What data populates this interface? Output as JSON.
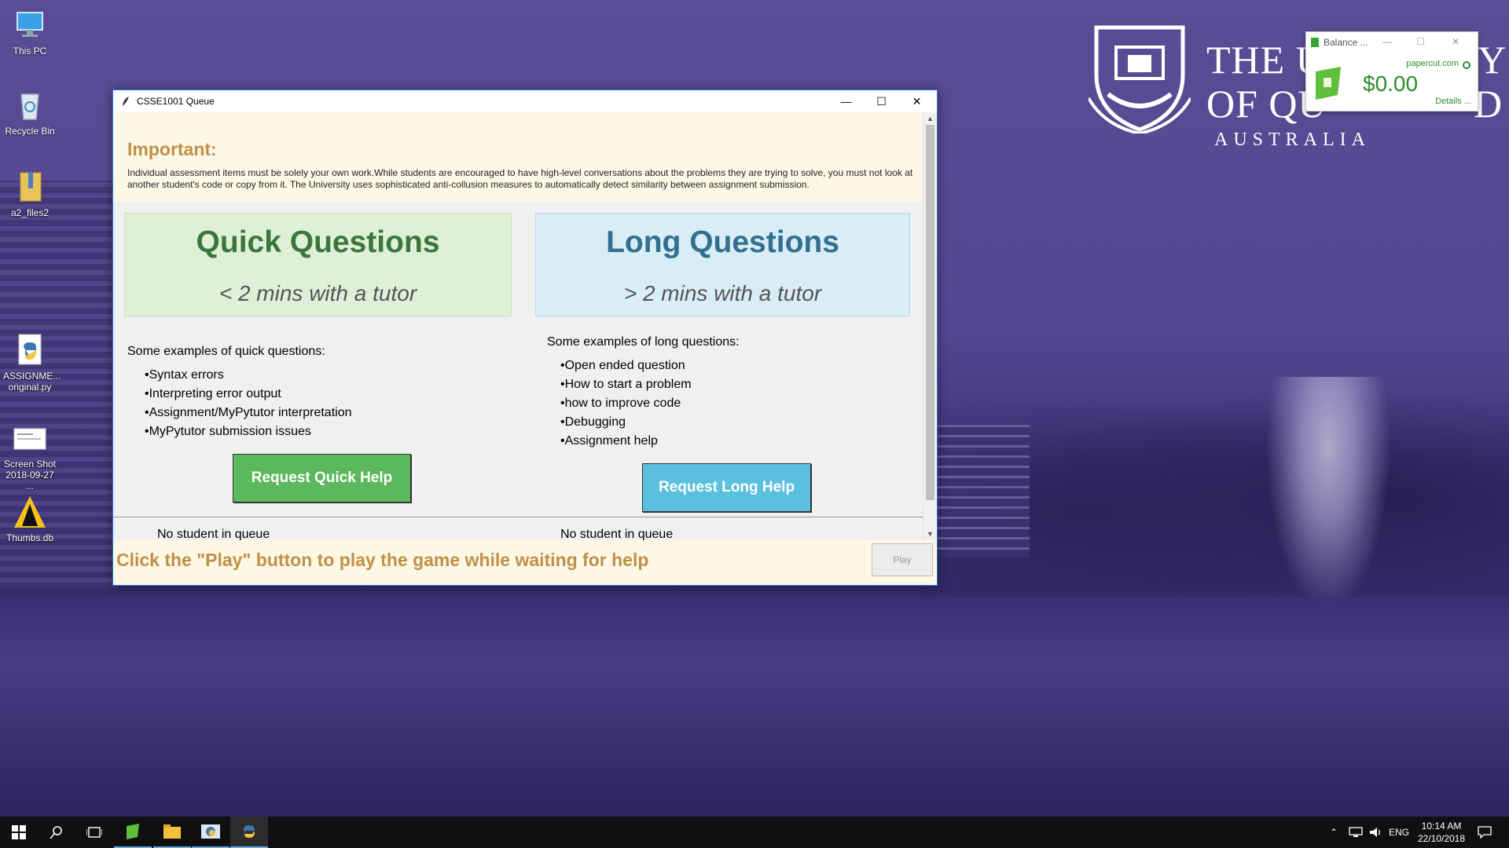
{
  "desktop": {
    "icons": [
      {
        "label": "This PC"
      },
      {
        "label": "Recycle Bin"
      },
      {
        "label": "a2_files2"
      },
      {
        "label": "ASSIGNME... original.py"
      },
      {
        "label": "Screen Shot 2018-09-27 ..."
      },
      {
        "label": "Thumbs.db"
      }
    ],
    "wallpaper": {
      "logo_line1": "THE U",
      "logo_line2": "OF QU",
      "logo_line3": "AUSTRALIA",
      "logo_tail1": "Y",
      "logo_tail2": "D"
    }
  },
  "papercut": {
    "title": "Balance ...",
    "site": "papercut.com",
    "amount": "$0.00",
    "details": "Details ..."
  },
  "window": {
    "title": "CSSE1001 Queue",
    "important_heading": "Important:",
    "important_text": "Individual assessment items must be solely your own work.While students are encouraged to have high-level conversations about the problems they are trying to solve, you must not look at another student's code or copy from it. The University uses sophisticated anti-collusion measures to automatically detect similarity between assignment submission.",
    "quick": {
      "heading": "Quick Questions",
      "sub": "< 2 mins with a tutor",
      "examples_heading": "Some examples of quick questions:",
      "examples": [
        "•Syntax errors",
        "•Interpreting error output",
        "•Assignment/MyPytutor interpretation",
        "•MyPytutor submission issues"
      ],
      "button": "Request Quick Help",
      "queue_status": "No student in queue"
    },
    "long": {
      "heading": "Long Questions",
      "sub": "> 2 mins with a tutor",
      "examples_heading": "Some examples of long questions:",
      "examples": [
        "•Open ended question",
        "•How to start a problem",
        "•how to improve code",
        "•Debugging",
        "•Assignment help"
      ],
      "button": "Request Long Help",
      "queue_status": "No student in queue"
    },
    "play_hint": "Click the \"Play\" button to play the game while waiting for help",
    "play_button": "Play"
  },
  "taskbar": {
    "language": "ENG",
    "time": "10:14 AM",
    "date": "22/10/2018"
  },
  "colors": {
    "important": "#c09046",
    "quick_green": "#3c763d",
    "long_blue": "#31708f",
    "quick_button": "#5cb85c",
    "long_button": "#5bc0de"
  }
}
